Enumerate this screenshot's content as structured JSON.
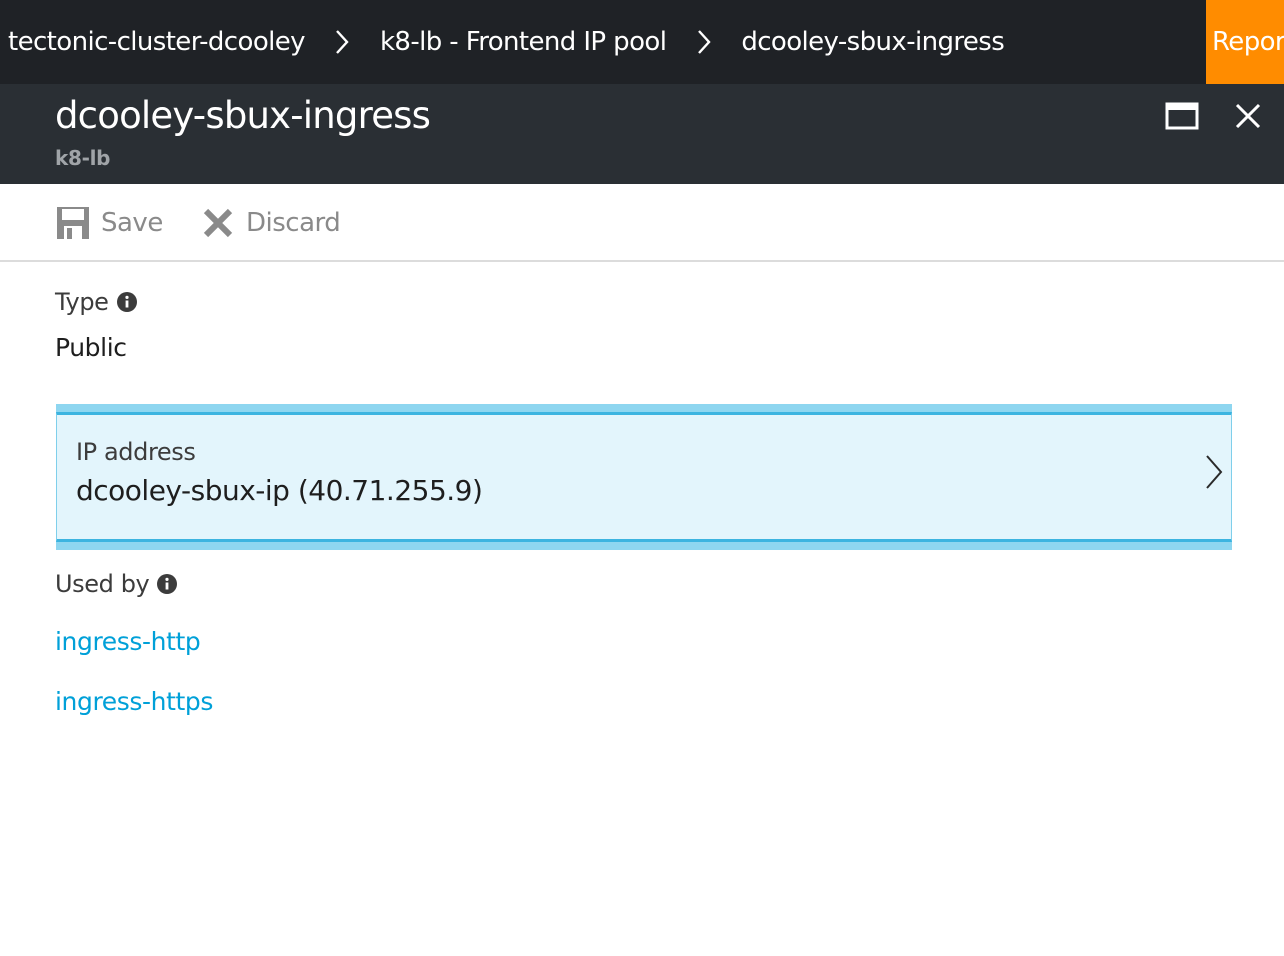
{
  "breadcrumb": {
    "items": [
      {
        "label": "tectonic-cluster-dcooley"
      },
      {
        "label": "k8-lb - Frontend IP pool"
      },
      {
        "label": "dcooley-sbux-ingress"
      }
    ],
    "report_label": "Report"
  },
  "blade": {
    "title": "dcooley-sbux-ingress",
    "subtitle": "k8-lb"
  },
  "toolbar": {
    "save_label": "Save",
    "discard_label": "Discard"
  },
  "type_field": {
    "label": "Type",
    "value": "Public"
  },
  "ip_address": {
    "label": "IP address",
    "value": "dcooley-sbux-ip (40.71.255.9)"
  },
  "used_by": {
    "label": "Used by",
    "items": [
      "ingress-http",
      "ingress-https"
    ]
  },
  "colors": {
    "top_bar": "#1f2226",
    "header": "#2a2f34",
    "report_accent": "#ff8c00",
    "link": "#00a0d8",
    "selection_fill": "#e3f5fc",
    "selection_border": "#3cb4e0"
  }
}
